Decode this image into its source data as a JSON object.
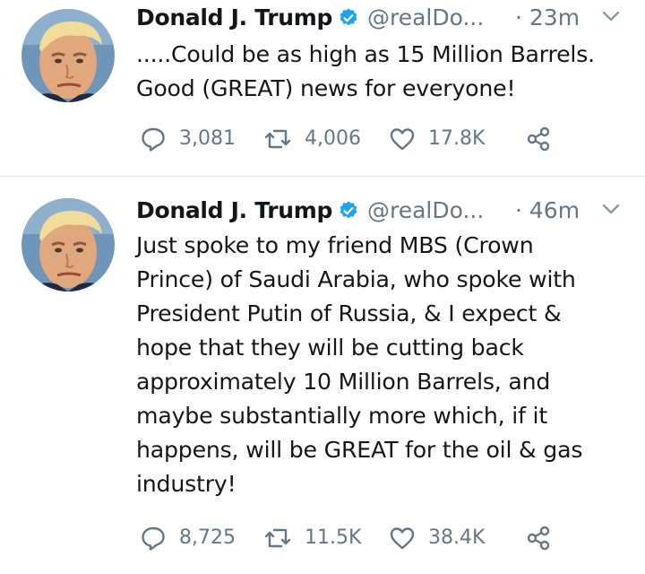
{
  "tweets": [
    {
      "author_name": "Donald J. Trump",
      "handle": "@realDo...",
      "time": "· 23m",
      "lines": [
        ".....Could be as high as 15 Million Barrels.",
        "Good (GREAT) news for everyone!"
      ],
      "replies": "3,081",
      "retweets": "4,006",
      "likes": "17.8K"
    },
    {
      "author_name": "Donald J. Trump",
      "handle": "@realDo...",
      "time": "· 46m",
      "lines": [
        "Just spoke to my friend MBS (Crown",
        "Prince) of Saudi Arabia, who spoke with",
        "President Putin of Russia, & I expect &",
        "hope that they will be cutting back",
        "approximately 10 Million Barrels, and",
        "maybe substantially more which, if it",
        "happens, will be GREAT for the oil & gas",
        "industry!"
      ],
      "replies": "8,725",
      "retweets": "11.5K",
      "likes": "38.4K"
    }
  ],
  "colors": {
    "text": "#14171a",
    "secondary": "#657786",
    "verified_blue": "#1da1f2",
    "divider": "#e1e8ed"
  },
  "icons": {
    "verified": "verified-badge-icon",
    "chevron": "chevron-down-icon",
    "reply": "reply-icon",
    "retweet": "retweet-icon",
    "like": "heart-icon",
    "share": "share-icon"
  }
}
